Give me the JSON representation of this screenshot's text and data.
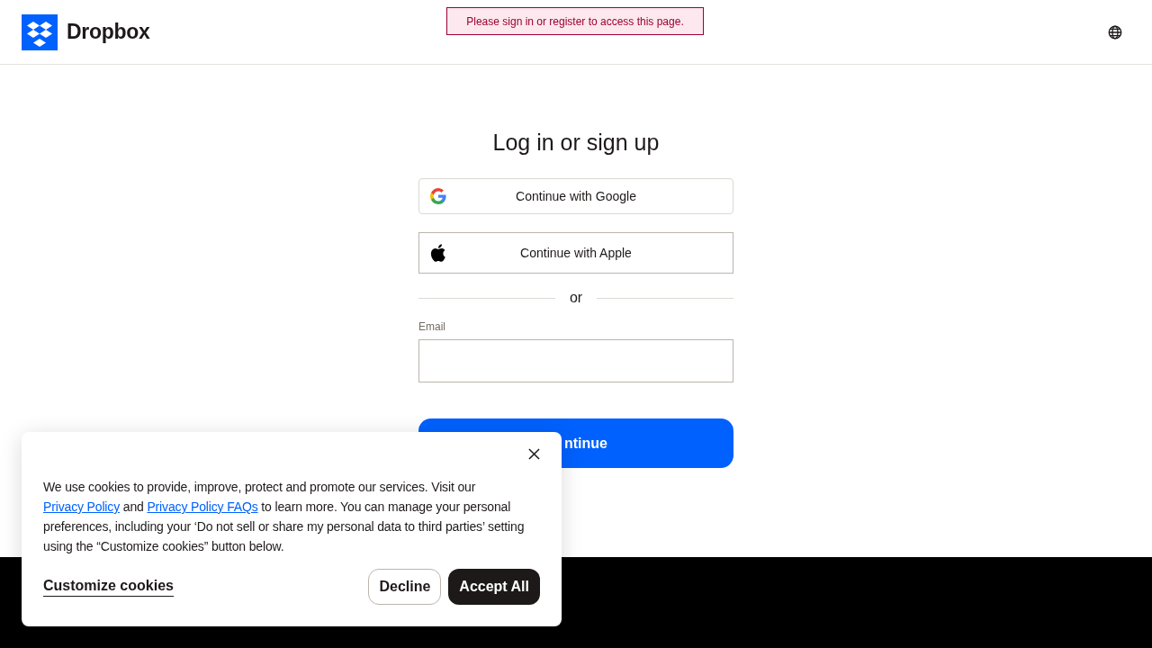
{
  "header": {
    "logo_text": "Dropbox",
    "alert": "Please sign in or register to access this page."
  },
  "form": {
    "title": "Log in or sign up",
    "providers": [
      {
        "kind": "google",
        "label": "Continue with Google"
      },
      {
        "kind": "apple",
        "label": "Continue with Apple"
      }
    ],
    "divider": "or",
    "email_label": "Email",
    "submit_visible_text": "ntinue"
  },
  "cookie_banner": {
    "parts": [
      {
        "kind": "text",
        "text": "We use cookies to provide, improve, protect and promote our services. Visit our "
      },
      {
        "kind": "link",
        "text": "Privacy Policy"
      },
      {
        "kind": "text",
        "text": " and "
      },
      {
        "kind": "link",
        "text": "Privacy Policy FAQs"
      },
      {
        "kind": "text",
        "text": " to learn more. You can manage your personal preferences, including your ‘Do not sell or share my personal data to third parties’ setting using the “Customize cookies” button below."
      }
    ],
    "customize": "Customize cookies",
    "decline": "Decline",
    "accept": "Accept All"
  }
}
